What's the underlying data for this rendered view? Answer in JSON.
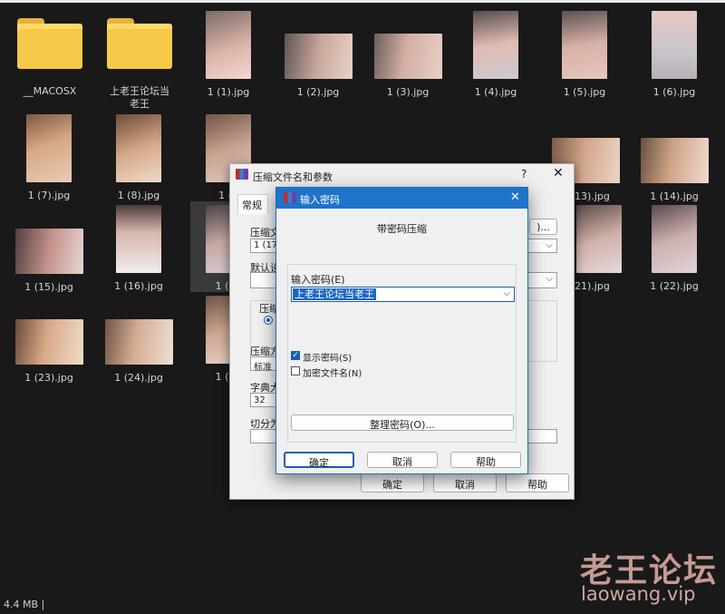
{
  "explorer": {
    "items": [
      {
        "name": "__MACOSX",
        "type": "folder"
      },
      {
        "name": "上老王论坛当老王",
        "type": "folder"
      },
      {
        "name": "1 (1).jpg"
      },
      {
        "name": "1 (2).jpg"
      },
      {
        "name": "1 (3).jpg"
      },
      {
        "name": "1 (4).jpg"
      },
      {
        "name": "1 (5).jpg"
      },
      {
        "name": "1 (6).jpg"
      },
      {
        "name": "1 (7).jpg"
      },
      {
        "name": "1 (8).jpg"
      },
      {
        "name": "1 (9"
      },
      {
        "name": "1 (13).jpg"
      },
      {
        "name": "1 (14).jpg"
      },
      {
        "name": "1 (15).jpg"
      },
      {
        "name": "1 (16).jpg"
      },
      {
        "name": "1 (17"
      },
      {
        "name": "1 (21).jpg"
      },
      {
        "name": "1 (22).jpg"
      },
      {
        "name": "1 (23).jpg"
      },
      {
        "name": "1 (24).jpg"
      },
      {
        "name": "1 (25"
      }
    ],
    "status": "4.4 MB  |"
  },
  "archive_dialog": {
    "title": "压缩文件名和参数",
    "help": "?",
    "close": "✕",
    "tab_general": "常规",
    "archive_name_label": "压缩文",
    "archive_name_value": "1 (17).",
    "browse_button": ")...",
    "default_profile_label": "默认设",
    "format_group_label": "压缩",
    "method_label": "压缩方",
    "method_value": "标准",
    "dict_label": "字典大",
    "dict_value": "32",
    "split_label": "切分为",
    "ok": "确定",
    "cancel": "取消",
    "help_button": "帮助"
  },
  "password_dialog": {
    "title": "输入密码",
    "close": "✕",
    "heading": "带密码压缩",
    "password_label": "输入密码(E)",
    "password_value": "上老王论坛当老王",
    "show_password": "显示密码(S)",
    "show_password_checked": true,
    "encrypt_names": "加密文件名(N)",
    "encrypt_names_checked": false,
    "organize_button": "整理密码(O)...",
    "ok": "确定",
    "cancel": "取消",
    "help": "帮助"
  },
  "watermark": {
    "cn": "老王论坛",
    "url": "laowang.vip"
  }
}
